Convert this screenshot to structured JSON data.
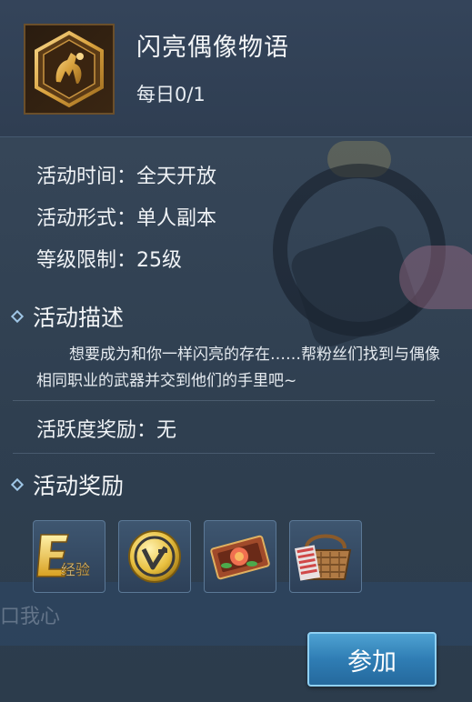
{
  "header": {
    "title": "闪亮偶像物语",
    "daily": "每日0/1"
  },
  "info": {
    "time": "活动时间：全天开放",
    "form": "活动形式：单人副本",
    "level": "等级限制：25级"
  },
  "description": {
    "heading": "活动描述",
    "text": "想要成为和你一样闪亮的存在……帮粉丝们找到与偶像相同职业的武器并交到他们的手里吧~"
  },
  "activity_reward": "活跃度奖励：无",
  "rewards": {
    "heading": "活动奖励",
    "items": [
      {
        "name": "exp-icon",
        "label": "经验"
      },
      {
        "name": "coin-icon"
      },
      {
        "name": "flower-ticket-icon"
      },
      {
        "name": "gift-basket-icon"
      }
    ]
  },
  "background_text": "口我心",
  "join_button": "参加"
}
